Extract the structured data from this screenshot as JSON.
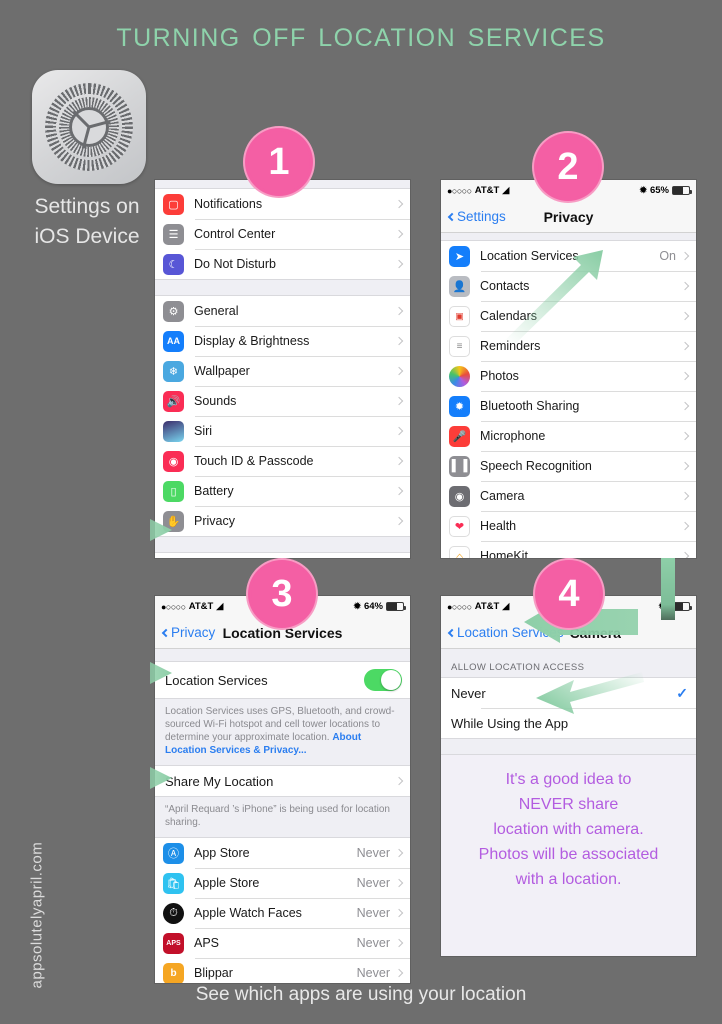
{
  "title": "Turning Off Location Services",
  "settings_block": {
    "icon": "settings-gear-icon",
    "label_line1": "Settings on",
    "label_line2": "iOS Device"
  },
  "bottom_caption": "See which apps are using your location",
  "watermark": "appsolutelyapril.com",
  "badges": {
    "one": "1",
    "two": "2",
    "three": "3",
    "four": "4"
  },
  "colors": {
    "background": "#6e6e6e",
    "title": "#8ed3ab",
    "badge_pink": "#f45fa4",
    "arrow_green": "#8ecfa8",
    "tip_purple": "#b35ce0",
    "ios_blue": "#2b7ef0",
    "switch_green": "#4cd964"
  },
  "phone1": {
    "groups": [
      [
        {
          "label": "Notifications",
          "icon": "notifications-icon",
          "icon_color": "#fc3d39",
          "chevron": "chevron-right-icon"
        },
        {
          "label": "Control Center",
          "icon": "control-center-icon",
          "icon_color": "#8e8e93",
          "chevron": "chevron-right-icon"
        },
        {
          "label": "Do Not Disturb",
          "icon": "do-not-disturb-icon",
          "icon_color": "#5856d6",
          "chevron": "chevron-right-icon"
        }
      ],
      [
        {
          "label": "General",
          "icon": "general-gear-icon",
          "icon_color": "#8e8e93",
          "chevron": "chevron-right-icon"
        },
        {
          "label": "Display & Brightness",
          "icon": "display-brightness-icon",
          "icon_color": "#147efb",
          "chevron": "chevron-right-icon"
        },
        {
          "label": "Wallpaper",
          "icon": "wallpaper-icon",
          "icon_color": "#4aa8e0",
          "chevron": "chevron-right-icon"
        },
        {
          "label": "Sounds",
          "icon": "sounds-icon",
          "icon_color": "#fa2d55",
          "chevron": "chevron-right-icon"
        },
        {
          "label": "Siri",
          "icon": "siri-icon",
          "icon_color": "#3b2d6b",
          "chevron": "chevron-right-icon"
        },
        {
          "label": "Touch ID & Passcode",
          "icon": "touch-id-icon",
          "icon_color": "#fa2d55",
          "chevron": "chevron-right-icon"
        },
        {
          "label": "Battery",
          "icon": "battery-icon",
          "icon_color": "#4cd964",
          "chevron": "chevron-right-icon"
        },
        {
          "label": "Privacy",
          "icon": "privacy-hand-icon",
          "icon_color": "#8e8e93",
          "chevron": "chevron-right-icon"
        }
      ]
    ]
  },
  "phone2": {
    "statusbar": {
      "carrier": "AT&T",
      "signal": "●○○○○",
      "wifi": "wifi-icon",
      "bluetooth": "bluetooth-icon",
      "battery_pct": "65%"
    },
    "nav": {
      "back": "Settings",
      "title": "Privacy"
    },
    "rows": [
      {
        "label": "Location Services",
        "value": "On",
        "icon": "location-arrow-icon",
        "icon_color": "#147efb"
      },
      {
        "label": "Contacts",
        "value": "",
        "icon": "contacts-icon",
        "icon_color": "#b9bcc2"
      },
      {
        "label": "Calendars",
        "value": "",
        "icon": "calendar-icon",
        "icon_color": "#ffffff"
      },
      {
        "label": "Reminders",
        "value": "",
        "icon": "reminders-icon",
        "icon_color": "#ffffff"
      },
      {
        "label": "Photos",
        "value": "",
        "icon": "photos-icon",
        "icon_color": "#ffffff"
      },
      {
        "label": "Bluetooth Sharing",
        "value": "",
        "icon": "bluetooth-sharing-icon",
        "icon_color": "#147efb"
      },
      {
        "label": "Microphone",
        "value": "",
        "icon": "microphone-icon",
        "icon_color": "#fc3d39"
      },
      {
        "label": "Speech Recognition",
        "value": "",
        "icon": "speech-recognition-icon",
        "icon_color": "#8e8e93"
      },
      {
        "label": "Camera",
        "value": "",
        "icon": "camera-icon",
        "icon_color": "#6d6d72"
      },
      {
        "label": "Health",
        "value": "",
        "icon": "health-heart-icon",
        "icon_color": "#ffffff"
      },
      {
        "label": "HomeKit",
        "value": "",
        "icon": "homekit-icon",
        "icon_color": "#ffffff"
      }
    ]
  },
  "phone3": {
    "statusbar": {
      "carrier": "AT&T",
      "signal": "●○○○○",
      "wifi": "wifi-icon",
      "bluetooth": "bluetooth-icon",
      "battery_pct": "64%"
    },
    "nav": {
      "back": "Privacy",
      "title": "Location Services"
    },
    "toggle_row": {
      "label": "Location Services",
      "state": "on"
    },
    "blurb_text": "Location Services uses GPS, Bluetooth, and crowd-sourced Wi-Fi hotspot and cell tower locations to determine your approximate location. ",
    "blurb_link": "About Location Services & Privacy...",
    "share_row": {
      "label": "Share My Location"
    },
    "share_note": "“April Requard   ’s iPhone” is being used for location sharing.",
    "apps": [
      {
        "label": "App Store",
        "value": "Never",
        "icon": "app-store-icon",
        "icon_color": "#1d8fe8"
      },
      {
        "label": "Apple Store",
        "value": "Never",
        "icon": "apple-store-icon",
        "icon_color": "#2fc2f0"
      },
      {
        "label": "Apple Watch Faces",
        "value": "Never",
        "icon": "apple-watch-faces-icon",
        "icon_color": "#111111"
      },
      {
        "label": "APS",
        "value": "Never",
        "icon": "aps-icon",
        "icon_color": "#c2102a"
      },
      {
        "label": "Blippar",
        "value": "Never",
        "icon": "blippar-icon",
        "icon_color": "#f5a623"
      }
    ]
  },
  "phone4": {
    "statusbar": {
      "carrier": "AT&T",
      "signal": "●○○○○",
      "wifi": "wifi-icon",
      "bluetooth": "bluetooth-icon",
      "battery_pct": ""
    },
    "nav": {
      "back": "Location Services",
      "title": "Camera"
    },
    "section_header": "ALLOW LOCATION ACCESS",
    "options": [
      {
        "label": "Never",
        "selected": true
      },
      {
        "label": "While Using the App",
        "selected": false
      }
    ],
    "tip_lines": [
      "It's a good idea to",
      "NEVER share",
      "location with camera.",
      "Photos will be associated",
      "with a location."
    ]
  }
}
